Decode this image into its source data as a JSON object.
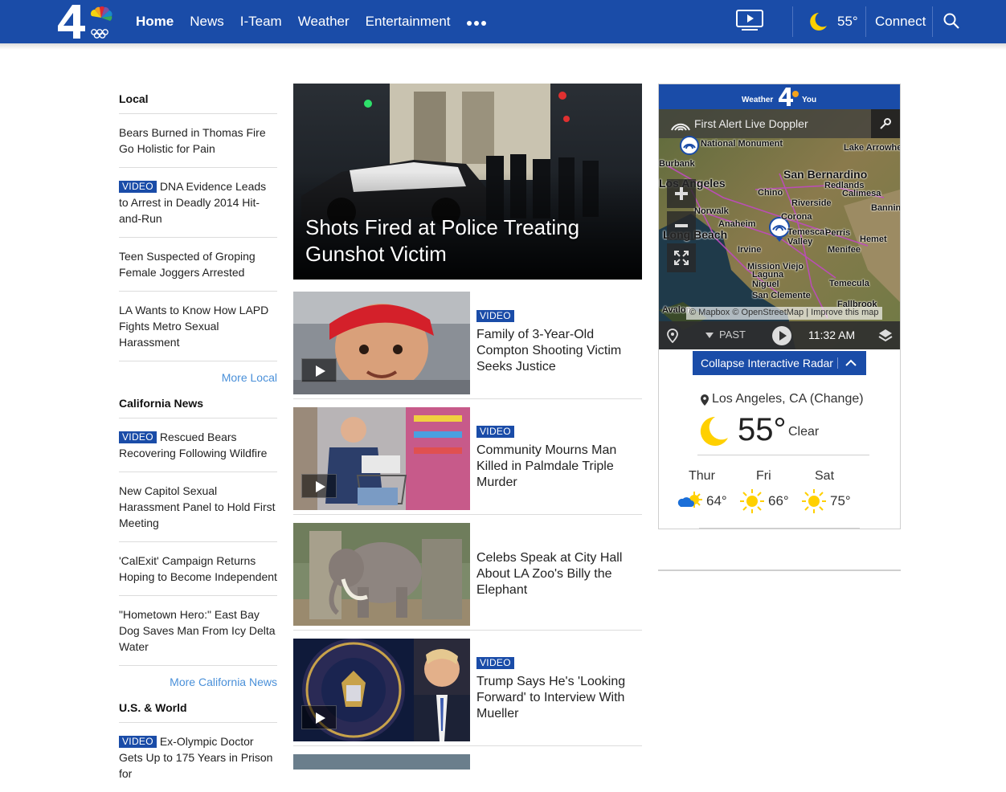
{
  "header": {
    "nav": [
      "Home",
      "News",
      "I-Team",
      "Weather",
      "Entertainment"
    ],
    "temp": "55°",
    "connect": "Connect"
  },
  "sections": {
    "local": {
      "title": "Local",
      "stories": [
        {
          "video": false,
          "text": "Bears Burned in Thomas Fire Go Holistic for Pain"
        },
        {
          "video": true,
          "text": "DNA Evidence Leads to Arrest in Deadly 2014 Hit-and-Run"
        },
        {
          "video": false,
          "text": "Teen Suspected of Groping Female Joggers Arrested"
        },
        {
          "video": false,
          "text": "LA Wants to Know How LAPD Fights Metro Sexual Harassment"
        }
      ],
      "more": "More Local"
    },
    "california": {
      "title": "California News",
      "stories": [
        {
          "video": true,
          "text": "Rescued Bears Recovering Following Wildfire"
        },
        {
          "video": false,
          "text": "New Capitol Sexual Harassment Panel to Hold First Meeting"
        },
        {
          "video": false,
          "text": "'CalExit' Campaign Returns Hoping to Become Independent"
        },
        {
          "video": false,
          "text": "\"Hometown Hero:\" East Bay Dog Saves Man From Icy Delta Water"
        }
      ],
      "more": "More California News"
    },
    "usworld": {
      "title": "U.S. & World",
      "stories": [
        {
          "video": true,
          "text": "Ex-Olympic Doctor Gets Up to 175 Years in Prison for"
        }
      ]
    }
  },
  "video_badge": "VIDEO",
  "hero": {
    "title": "Shots Fired at Police Treating Gunshot Victim"
  },
  "cards": [
    {
      "video": true,
      "title": "Family of 3-Year-Old Compton Shooting Victim Seeks Justice"
    },
    {
      "video": true,
      "title": "Community Mourns Man Killed in Palmdale Triple Murder"
    },
    {
      "video": false,
      "title": "Celebs Speak at City Hall About LA Zoo's Billy the Elephant"
    },
    {
      "video": true,
      "title": "Trump Says He's 'Looking Forward' to Interview With Mueller"
    }
  ],
  "weather": {
    "header_left": "Weather",
    "header_right": "You",
    "map_title": "First Alert Live Doppler",
    "map_labels": {
      "national_monument": "National Monument",
      "lake_arrowhead": "Lake Arrowhead",
      "burbank": "Burbank",
      "los_angeles": "Los Angeles",
      "san_bernardino": "San Bernardino",
      "redlands": "Redlands",
      "chino": "Chino",
      "calimesa": "Calimesa",
      "riverside": "Riverside",
      "norwalk": "Norwalk",
      "banning": "Banning",
      "corona": "Corona",
      "anaheim": "Anaheim",
      "long_beach": "Long Beach",
      "temescal_valley": "Temescal Valley",
      "perris": "Perris",
      "hemet": "Hemet",
      "irvine": "Irvine",
      "menifee": "Menifee",
      "mission_viejo": "Mission Viejo",
      "laguna_niguel": "Laguna Niguel",
      "temecula": "Temecula",
      "san_clemente": "San Clemente",
      "fallbrook": "Fallbrook",
      "avalon": "Avalon"
    },
    "attribution": "© Mapbox © OpenStreetMap | Improve this map",
    "past": "PAST",
    "time": "11:32 AM",
    "collapse": "Collapse Interactive Radar",
    "location": "Los Angeles, CA (Change)",
    "current_temp": "55°",
    "current_desc": "Clear",
    "forecast": [
      {
        "day": "Thur",
        "temp": "64°",
        "icon": "partly-cloudy-icon"
      },
      {
        "day": "Fri",
        "temp": "66°",
        "icon": "sun-icon"
      },
      {
        "day": "Sat",
        "temp": "75°",
        "icon": "sun-icon"
      }
    ],
    "colors": {
      "brand": "#1a4ca8",
      "moon": "#ffd000",
      "link": "#4a90d9"
    }
  }
}
